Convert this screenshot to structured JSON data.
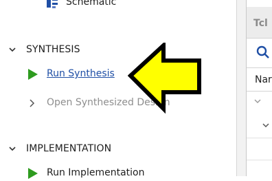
{
  "flow_navigator": {
    "schematic": {
      "label": "Schematic",
      "icon": "schematic-icon"
    },
    "synthesis": {
      "title": "SYNTHESIS",
      "run_label": "Run Synthesis",
      "open_label": "Open Synthesized Design"
    },
    "implementation": {
      "title": "IMPLEMENTATION",
      "run_label": "Run Implementation"
    }
  },
  "right_panel": {
    "tab_label": "Tcl",
    "name_header": "Nar"
  },
  "callout": {
    "icon": "yellow-arrow-icon",
    "fill": "#ffff00",
    "stroke": "#000000"
  },
  "colors": {
    "run_green": "#2e9b1f",
    "link_blue": "#1f4fa5",
    "disabled_gray": "#8e8e8e"
  }
}
